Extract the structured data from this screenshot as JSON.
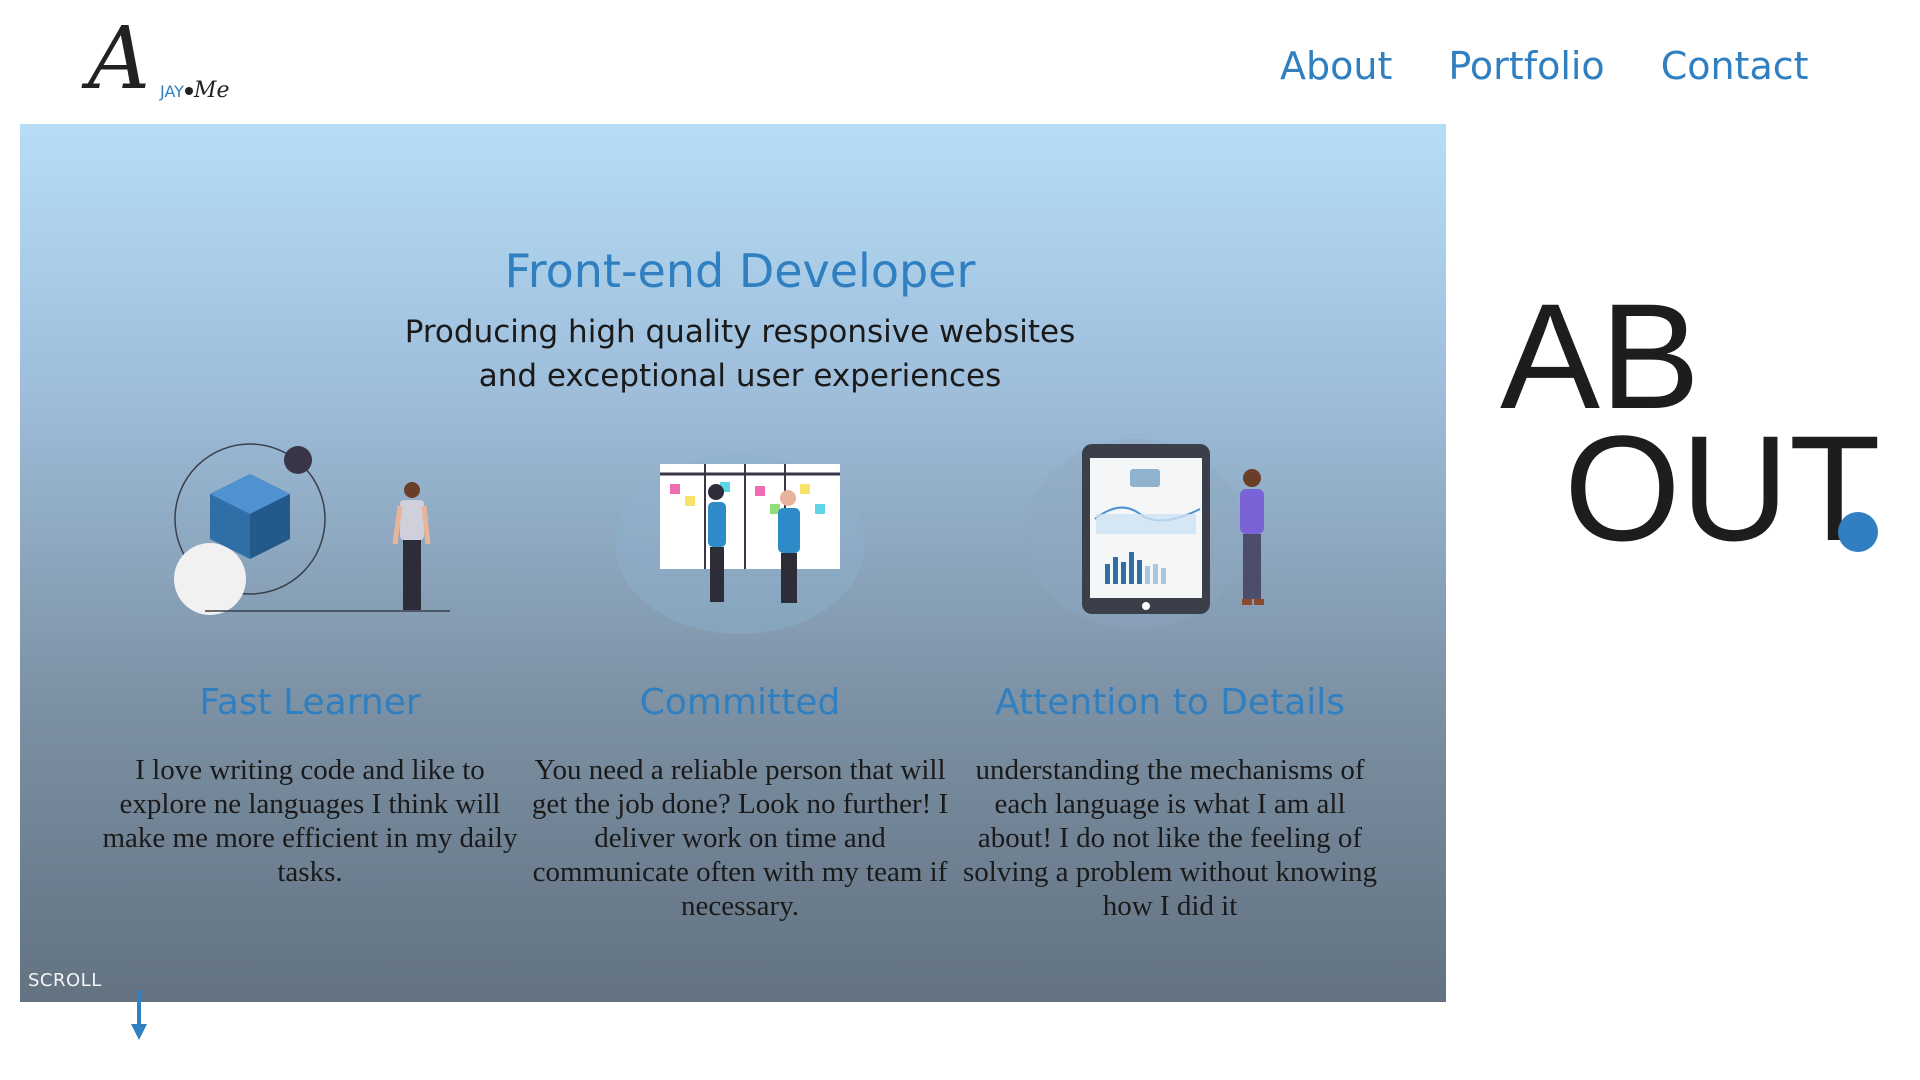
{
  "brand": {
    "logo_main": "A",
    "logo_jay": "JAY",
    "logo_me": "Me"
  },
  "nav": {
    "items": [
      "About",
      "Portfolio",
      "Contact"
    ]
  },
  "hero": {
    "title": "Front-end Developer",
    "subtitle_line1": "Producing high quality responsive websites",
    "subtitle_line2": "and exceptional user experiences",
    "scroll_label": "SCROLL"
  },
  "features": [
    {
      "title": "Fast Learner",
      "text": "I love writing code and like to explore ne languages I think will make me more efficient in my daily tasks."
    },
    {
      "title": "Committed",
      "text": "You need a reliable person that will get the job done? Look no further! I deliver work on time and communicate often with my team if necessary."
    },
    {
      "title": "Attention to Details",
      "text": "understanding the mechanisms of each language is what I am all about! I do not like the feeling of solving a problem without knowing how I did it"
    }
  ],
  "about_heading": {
    "line1": "AB",
    "line2": "OUT"
  },
  "colors": {
    "accent": "#2f7fc1",
    "text_dark": "#1d1d1d"
  }
}
